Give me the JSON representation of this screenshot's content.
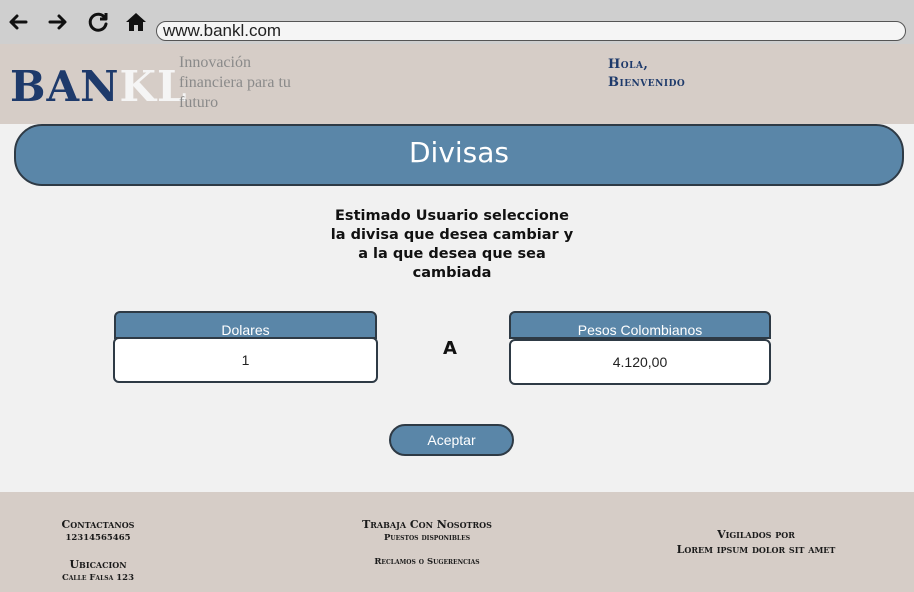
{
  "browser": {
    "url": "www.bankl.com",
    "nav_icons": [
      "back-arrow-icon",
      "forward-arrow-icon",
      "reload-icon",
      "home-icon"
    ]
  },
  "header": {
    "logo_part1": "BAN",
    "logo_part2": "KL",
    "tagline_line1": "Innovación",
    "tagline_line2": "financiera para tu",
    "tagline_line3": "futuro",
    "greeting_line1": "Hola,",
    "greeting_line2": "Bienvenido"
  },
  "main": {
    "title": "Divisas",
    "instructions_line1": "Estimado Usuario seleccione",
    "instructions_line2": "la divisa que desea cambiar y",
    "instructions_line3": "a la que desea que sea",
    "instructions_line4": "cambiada",
    "from_currency": "Dolares",
    "from_value": "1",
    "separator": "A",
    "to_currency": "Pesos Colombianos",
    "to_value": "4.120,00",
    "accept_label": "Aceptar"
  },
  "footer": {
    "contact_title": "Contactanos",
    "contact_phone": "12314565465",
    "location_title": "Ubicacion",
    "location_address": "Calle Falsa 123",
    "work_title": "Trabaja Con Nosotros",
    "work_sub": "Puestos disponibles",
    "claims": "Reclamos o Sugerencias",
    "supervised_title": "Vigilados por",
    "supervised_sub": "Lorem ipsum dolor sit amet"
  },
  "colors": {
    "accent": "#5a86a8",
    "brand_navy": "#1e3a6b",
    "header_bg": "#d6cdc7",
    "page_bg": "#f1f1f1"
  }
}
